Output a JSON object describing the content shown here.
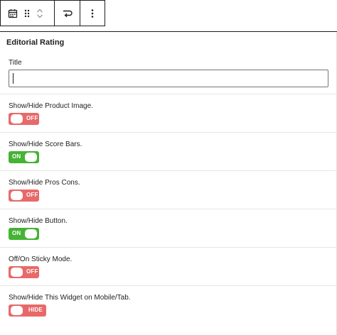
{
  "panel": {
    "title": "Editorial Rating",
    "title_field": {
      "label": "Title",
      "value": "",
      "placeholder": ""
    }
  },
  "settings": [
    {
      "label": "Show/Hide Product Image.",
      "state": "OFF",
      "on": false
    },
    {
      "label": "Show/Hide Score Bars.",
      "state": "ON",
      "on": true
    },
    {
      "label": "Show/Hide Pros Cons.",
      "state": "OFF",
      "on": false
    },
    {
      "label": "Show/Hide Button.",
      "state": "ON",
      "on": true
    },
    {
      "label": "Off/On Sticky Mode.",
      "state": "OFF",
      "on": false
    },
    {
      "label": "Show/Hide This Widget on Mobile/Tab.",
      "state": "HIDE",
      "on": false
    }
  ],
  "toolbar": {
    "icons": [
      "calendar-icon",
      "drag-handle-icon",
      "move-up-icon",
      "move-down-icon",
      "transform-icon",
      "more-options-icon"
    ]
  },
  "colors": {
    "toggle_off": "#e76a6a",
    "toggle_on": "#45b334",
    "border": "#1e1e1e"
  }
}
